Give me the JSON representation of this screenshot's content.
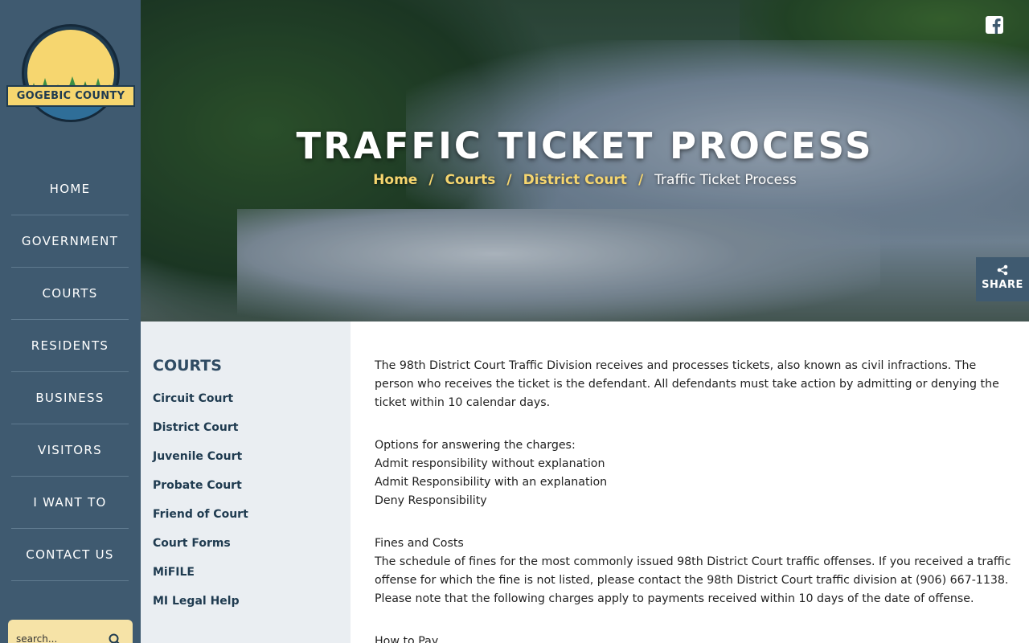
{
  "site": {
    "logo_text": "GOGEBIC COUNTY",
    "colors": {
      "nav_bg": "#3f5a70",
      "accent": "#f6d66f",
      "sidebar_bg": "#eaeef2"
    }
  },
  "main_nav": {
    "items": [
      {
        "label": "HOME"
      },
      {
        "label": "GOVERNMENT"
      },
      {
        "label": "COURTS"
      },
      {
        "label": "RESIDENTS"
      },
      {
        "label": "BUSINESS"
      },
      {
        "label": "VISITORS"
      },
      {
        "label": "I WANT TO"
      },
      {
        "label": "CONTACT US"
      }
    ]
  },
  "search": {
    "placeholder": "search...",
    "icon": "search-icon"
  },
  "hero": {
    "title": "TRAFFIC TICKET PROCESS",
    "breadcrumb": {
      "links": [
        "Home",
        "Courts",
        "District Court"
      ],
      "separator": "/",
      "current": "Traffic Ticket Process"
    },
    "social_icon": "facebook-icon",
    "share": {
      "label": "SHARE",
      "icon": "share-icon"
    }
  },
  "section_nav": {
    "title": "COURTS",
    "links": [
      "Circuit Court",
      "District Court",
      "Juvenile Court",
      "Probate Court",
      "Friend of Court",
      "Court Forms",
      "MiFILE",
      "MI Legal Help"
    ]
  },
  "article": {
    "intro": "The 98th District Court Traffic Division receives and processes tickets, also known as civil infractions. The person who receives the ticket is the defendant. All defendants must take action by admitting or denying the ticket within 10 calendar days.",
    "options_heading": "Options for answering the charges:",
    "options": [
      "Admit responsibility without explanation",
      "Admit Responsibility with an explanation",
      "Deny Responsibility"
    ],
    "fines_heading": "Fines and Costs",
    "fines_text": "The schedule of fines for the most commonly issued 98th District Court traffic offenses. If you received a traffic offense for which the fine is not listed, please contact the 98th District Court traffic division at (906) 667-1138. Please note that the following charges apply to payments received within 10 days of the date of offense.",
    "pay_heading": "How to Pay"
  }
}
